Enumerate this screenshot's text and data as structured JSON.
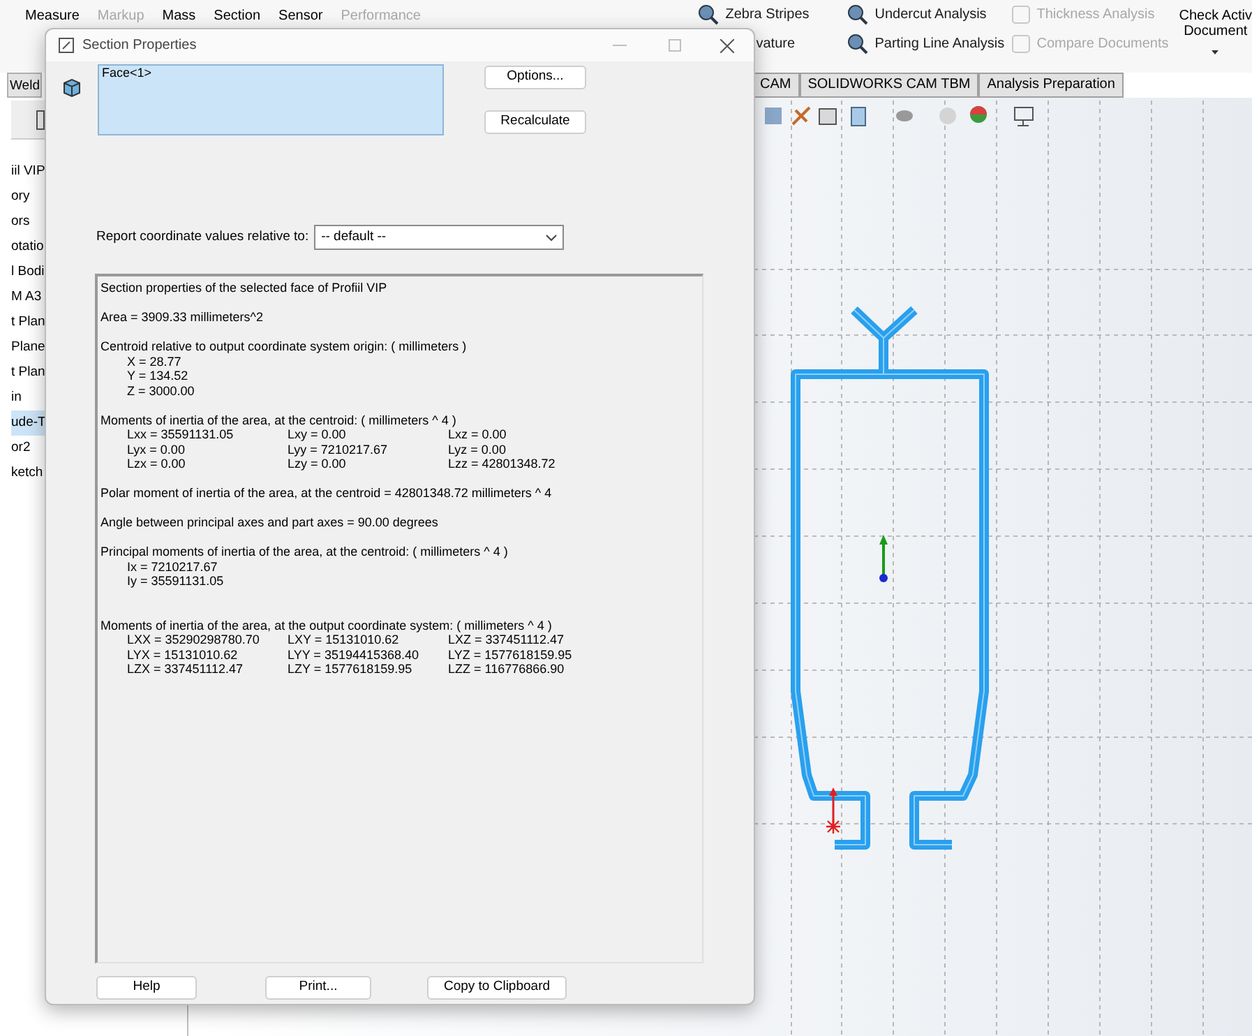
{
  "menu": [
    {
      "label": "Measure",
      "disabled": false
    },
    {
      "label": "Markup",
      "disabled": true
    },
    {
      "label": "Mass",
      "disabled": false
    },
    {
      "label": "Section",
      "disabled": false
    },
    {
      "label": "Sensor",
      "disabled": false
    },
    {
      "label": "Performance",
      "disabled": true
    }
  ],
  "analysis_tools": [
    {
      "label": "Zebra Stripes",
      "disabled": false
    },
    {
      "label": "Undercut Analysis",
      "disabled": false
    },
    {
      "label": "Thickness Analysis",
      "disabled": true
    },
    {
      "label": "vature",
      "disabled": false
    },
    {
      "label": "Parting Line Analysis",
      "disabled": false
    },
    {
      "label": "Compare Documents",
      "disabled": true
    }
  ],
  "check_active": [
    "Check Activ",
    "Document"
  ],
  "left_tab": "Weld",
  "tabs": [
    {
      "label": "CAM",
      "selected": false
    },
    {
      "label": "SOLIDWORKS CAM TBM",
      "selected": false
    },
    {
      "label": "Analysis Preparation",
      "selected": false
    }
  ],
  "tree": [
    {
      "label": "iil VIP",
      "selected": false
    },
    {
      "label": "ory",
      "selected": false
    },
    {
      "label": "ors",
      "selected": false
    },
    {
      "label": "otatio",
      "selected": false
    },
    {
      "label": "l Bodi",
      "selected": false
    },
    {
      "label": "M A3",
      "selected": false
    },
    {
      "label": "t Plan",
      "selected": false
    },
    {
      "label": "Plane",
      "selected": false
    },
    {
      "label": "t Plan",
      "selected": false
    },
    {
      "label": "in",
      "selected": false
    },
    {
      "label": "ude-T",
      "selected": true
    },
    {
      "label": "or2",
      "selected": false
    },
    {
      "label": "ketch",
      "selected": false
    }
  ],
  "dialog": {
    "title": "Section Properties",
    "selection": [
      "Face<1>"
    ],
    "side_buttons": [
      "Options...",
      "Recalculate"
    ],
    "report_label": "Report coordinate values relative to:",
    "report_value": "-- default --",
    "report": [
      {
        "kind": "line",
        "text": "Section properties of the selected face of Profiil VIP"
      },
      {
        "kind": "gap"
      },
      {
        "kind": "line",
        "text": "Area = 3909.33 millimeters^2"
      },
      {
        "kind": "gap"
      },
      {
        "kind": "line",
        "text": "Centroid relative to output coordinate system origin: ( millimeters )"
      },
      {
        "kind": "indent",
        "text": "X = 28.77"
      },
      {
        "kind": "indent",
        "text": "Y = 134.52"
      },
      {
        "kind": "indent",
        "text": "Z = 3000.00"
      },
      {
        "kind": "gap"
      },
      {
        "kind": "line",
        "text": "Moments of inertia of the area, at the centroid: ( millimeters ^ 4 )"
      },
      {
        "kind": "grid",
        "rows": [
          [
            "Lxx = 35591131.05",
            "Lxy = 0.00",
            "Lxz = 0.00"
          ],
          [
            "Lyx = 0.00",
            "Lyy = 7210217.67",
            "Lyz = 0.00"
          ],
          [
            "Lzx = 0.00",
            "Lzy = 0.00",
            "Lzz = 42801348.72"
          ]
        ]
      },
      {
        "kind": "gap"
      },
      {
        "kind": "line",
        "text": "Polar moment of inertia of the area, at the centroid = 42801348.72 millimeters ^ 4"
      },
      {
        "kind": "gap"
      },
      {
        "kind": "line",
        "text": "Angle between principal axes and part axes = 90.00 degrees"
      },
      {
        "kind": "gap"
      },
      {
        "kind": "line",
        "text": "Principal moments of inertia of the area, at the centroid: ( millimeters ^ 4 )"
      },
      {
        "kind": "indent",
        "text": "Ix = 7210217.67"
      },
      {
        "kind": "indent",
        "text": "Iy = 35591131.05"
      },
      {
        "kind": "gap"
      },
      {
        "kind": "gap"
      },
      {
        "kind": "line",
        "text": "Moments of inertia of the area, at the output coordinate system: ( millimeters ^ 4 )"
      },
      {
        "kind": "grid",
        "rows": [
          [
            "LXX = 35290298780.70",
            "LXY = 15131010.62",
            "LXZ = 337451112.47"
          ],
          [
            "LYX = 15131010.62",
            "LYY = 35194415368.40",
            "LYZ = 1577618159.95"
          ],
          [
            "LZX = 337451112.47",
            "LZY = 1577618159.95",
            "LZZ = 116776866.90"
          ]
        ]
      }
    ],
    "buttons": [
      "Help",
      "Print...",
      "Copy to Clipboard"
    ]
  }
}
